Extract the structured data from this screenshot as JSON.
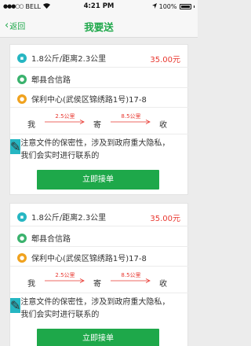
{
  "status_bar": {
    "carrier": "BELL",
    "time": "4:21 PM",
    "battery": "100%"
  },
  "nav": {
    "back_label": "返回",
    "title": "我要送"
  },
  "orders": [
    {
      "weight_distance": "1.8公斤/距离2.3公里",
      "price": "35.00元",
      "from": "郫县合信路",
      "to": "保利中心(武侯区锦绣路1号)17-8",
      "route": {
        "me": "我",
        "send": "寄",
        "receive": "收",
        "dist1": "2.5公里",
        "dist2": "8.5公里"
      },
      "note": "注意文件的保密性，涉及到政府重大隐私，我们会实时进行联系的",
      "button": "立即接单"
    },
    {
      "weight_distance": "1.8公斤/距离2.3公里",
      "price": "35.00元",
      "from": "郫县合信路",
      "to": "保利中心(武侯区锦绣路1号)17-8",
      "route": {
        "me": "我",
        "send": "寄",
        "receive": "收",
        "dist1": "2.5公里",
        "dist2": "8.5公里"
      },
      "note": "注意文件的保密性，涉及到政府重大隐私，我们会实时进行联系的",
      "button": "立即接单"
    }
  ],
  "colors": {
    "accent": "#1ea84a",
    "price": "#e8372f"
  }
}
